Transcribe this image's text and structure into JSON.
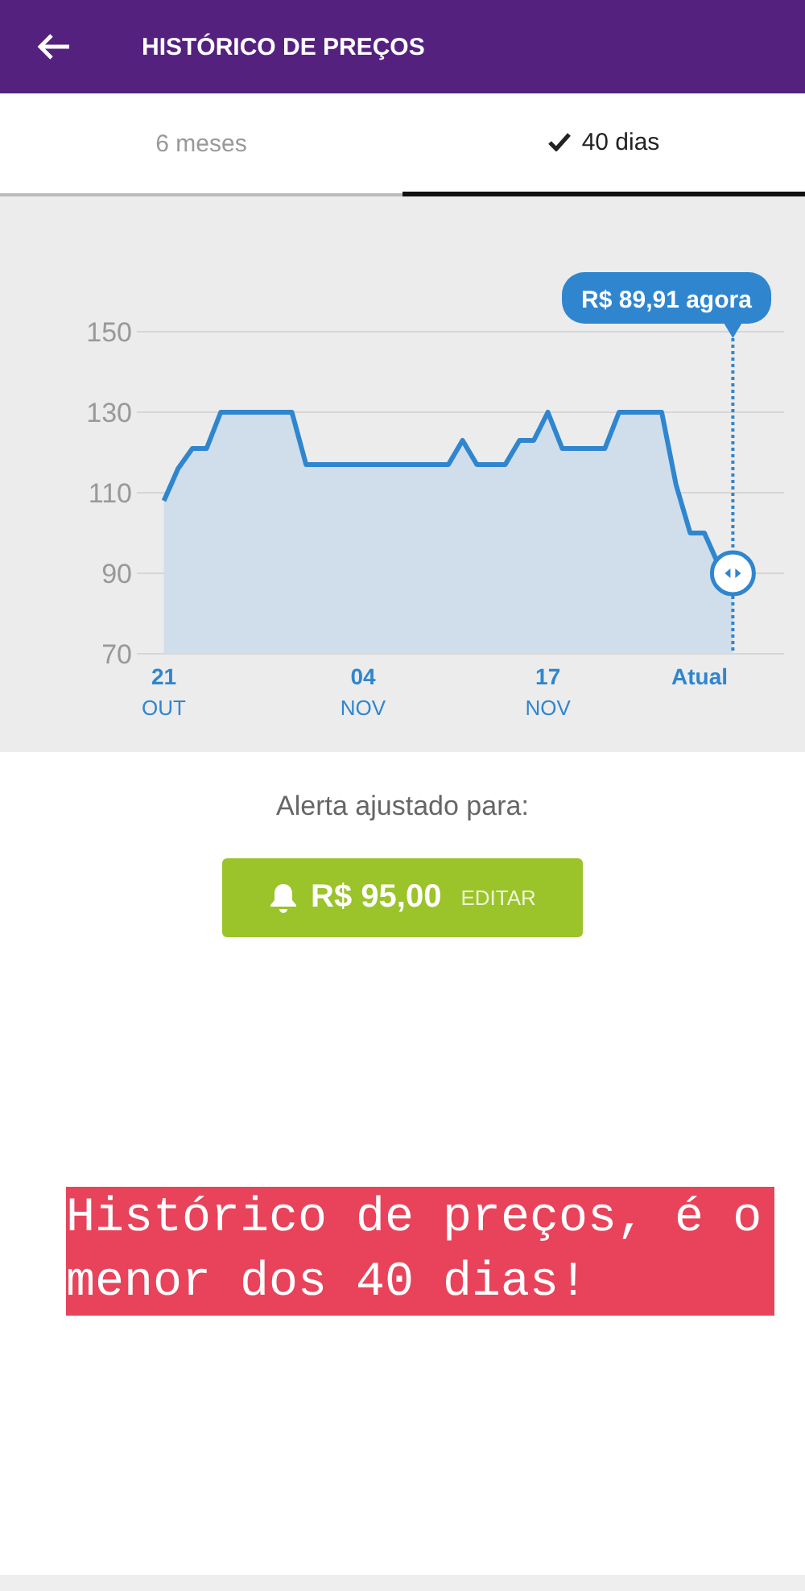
{
  "header": {
    "title": "HISTÓRICO DE PREÇOS"
  },
  "tabs": [
    {
      "label": "6 meses",
      "selected": false
    },
    {
      "label": "40 dias",
      "selected": true
    }
  ],
  "chart": {
    "chart_data": {
      "type": "area",
      "categories": [
        "21 OUT",
        null,
        null,
        null,
        null,
        null,
        null,
        null,
        null,
        null,
        null,
        null,
        null,
        null,
        "04 NOV",
        null,
        null,
        null,
        null,
        null,
        null,
        null,
        null,
        null,
        null,
        null,
        null,
        "17 NOV",
        null,
        null,
        null,
        null,
        null,
        null,
        null,
        null,
        null,
        null,
        "Atual",
        null,
        null
      ],
      "series": [
        {
          "color": "#2f86cf",
          "values": [
            108,
            116,
            121,
            121,
            130,
            130,
            130,
            130,
            130,
            130,
            117,
            117,
            117,
            117,
            117,
            117,
            117,
            117,
            117,
            117,
            117,
            123,
            117,
            117,
            117,
            123,
            123,
            130,
            121,
            121,
            121,
            121,
            130,
            130,
            130,
            130,
            112,
            100,
            100,
            92,
            90
          ]
        }
      ],
      "grid": true,
      "ylim": [
        70,
        150
      ],
      "yticks": [
        70,
        90,
        110,
        130,
        150
      ],
      "annotations": [
        "R$ 89,91 agora"
      ]
    }
  },
  "alert": {
    "label": "Alerta ajustado para:",
    "price": "R$ 95,00",
    "action": "EDITAR"
  },
  "caption": "Histórico de preços, é o menor dos 40 dias!"
}
